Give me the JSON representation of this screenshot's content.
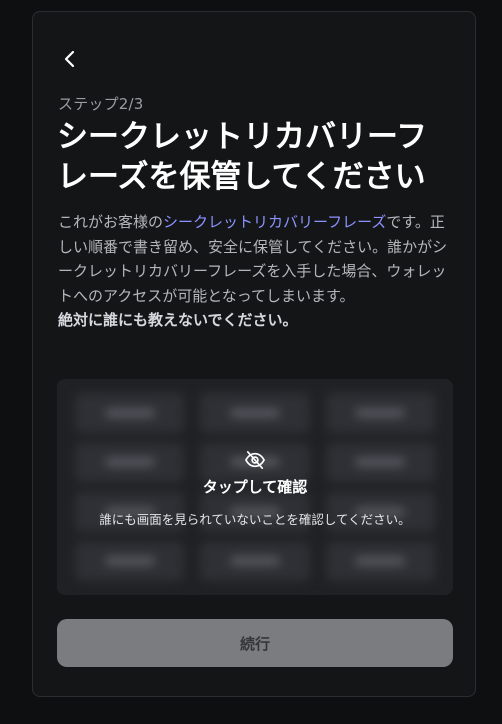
{
  "header": {
    "back_icon": "chevron-left-icon"
  },
  "step_label": "ステップ2/3",
  "title": "シークレットリカバリーフレーズを保管してください",
  "description": {
    "part1": "これがお客様の",
    "link": "シークレットリカバリーフレーズ",
    "part2": "です。正しい順番で書き留め、安全に保管してください。誰かがシークレットリカバリーフレーズを入手した場合、ウォレットへのアクセスが可能となってしまいます。",
    "warning": "絶対に誰にも教えないでください。"
  },
  "reveal": {
    "icon": "eye-slash-icon",
    "title": "タップして確認",
    "subtitle": "誰にも画面を見られていないことを確認してください。"
  },
  "continue_button": {
    "label": "続行"
  },
  "colors": {
    "background": "#0e0f11",
    "card": "#141517",
    "link": "#8b93ff",
    "button_disabled": "#7b7c80"
  }
}
